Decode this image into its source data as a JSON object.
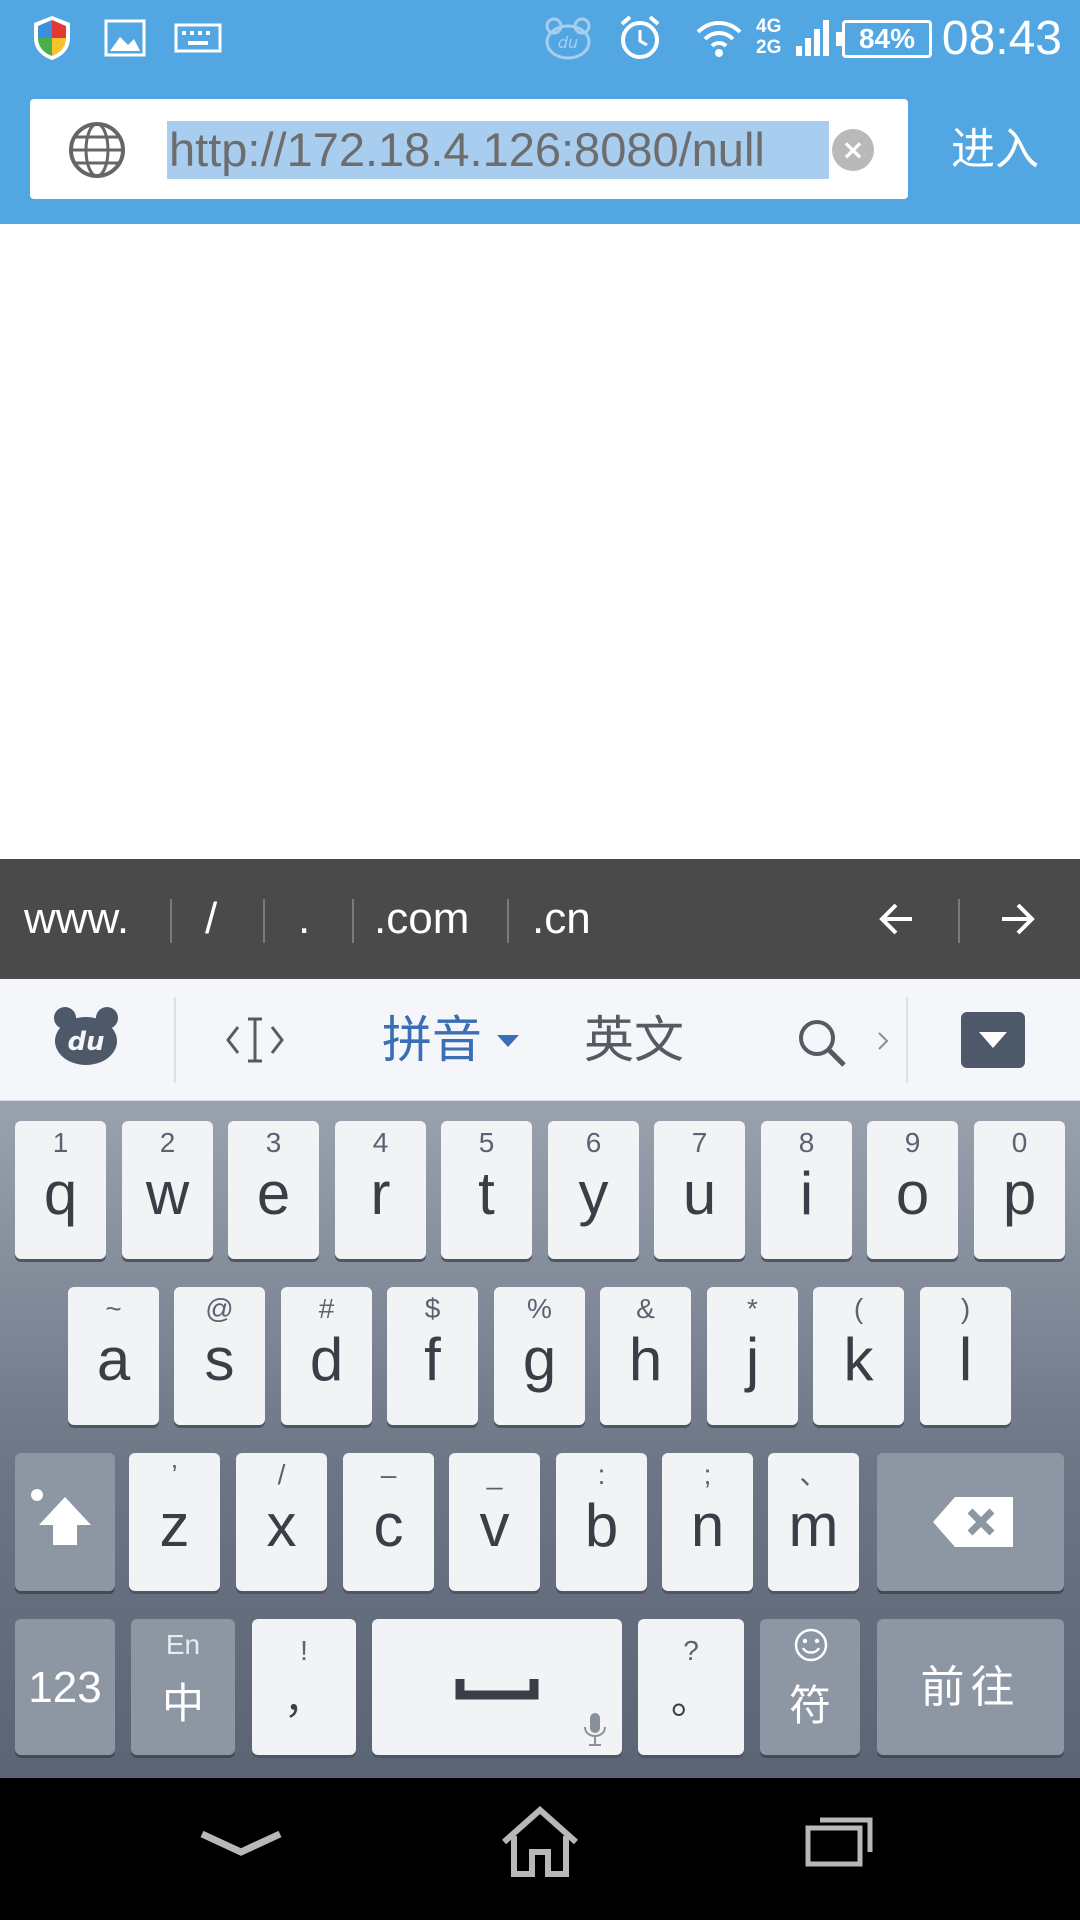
{
  "status_bar": {
    "time": "08:43",
    "battery": "84%",
    "network": [
      "4G",
      "2G"
    ],
    "icons": [
      "shield-icon",
      "gallery-icon",
      "keyboard-icon",
      "du-icon",
      "alarm-icon",
      "wifi-icon",
      "signal-icon",
      "battery-icon"
    ]
  },
  "url_bar": {
    "url": "http://172.18.4.126:8080/null",
    "go_label": "进入"
  },
  "shortcuts": [
    "www.",
    "/",
    ".",
    ".com",
    ".cn"
  ],
  "toolbar": {
    "pinyin_label": "拼音",
    "english_label": "英文"
  },
  "keyboard": {
    "row1": [
      {
        "hint": "1",
        "key": "q"
      },
      {
        "hint": "2",
        "key": "w"
      },
      {
        "hint": "3",
        "key": "e"
      },
      {
        "hint": "4",
        "key": "r"
      },
      {
        "hint": "5",
        "key": "t"
      },
      {
        "hint": "6",
        "key": "y"
      },
      {
        "hint": "7",
        "key": "u"
      },
      {
        "hint": "8",
        "key": "i"
      },
      {
        "hint": "9",
        "key": "o"
      },
      {
        "hint": "0",
        "key": "p"
      }
    ],
    "row2": [
      {
        "hint": "~",
        "key": "a"
      },
      {
        "hint": "@",
        "key": "s"
      },
      {
        "hint": "#",
        "key": "d"
      },
      {
        "hint": "$",
        "key": "f"
      },
      {
        "hint": "%",
        "key": "g"
      },
      {
        "hint": "&",
        "key": "h"
      },
      {
        "hint": "*",
        "key": "j"
      },
      {
        "hint": "(",
        "key": "k"
      },
      {
        "hint": ")",
        "key": "l"
      }
    ],
    "row3": [
      {
        "hint": "’",
        "key": "z"
      },
      {
        "hint": "/",
        "key": "x"
      },
      {
        "hint": "–",
        "key": "c"
      },
      {
        "hint": "_",
        "key": "v"
      },
      {
        "hint": ":",
        "key": "b"
      },
      {
        "hint": ";",
        "key": "n"
      },
      {
        "hint": "、",
        "key": "m"
      }
    ],
    "numbers_label": "123",
    "lang_top": "En",
    "lang_bottom": "中",
    "comma_hint": "!",
    "comma_key": "，",
    "period_hint": "?",
    "period_key": "。",
    "symbols_label": "符",
    "enter_label": "前往"
  }
}
